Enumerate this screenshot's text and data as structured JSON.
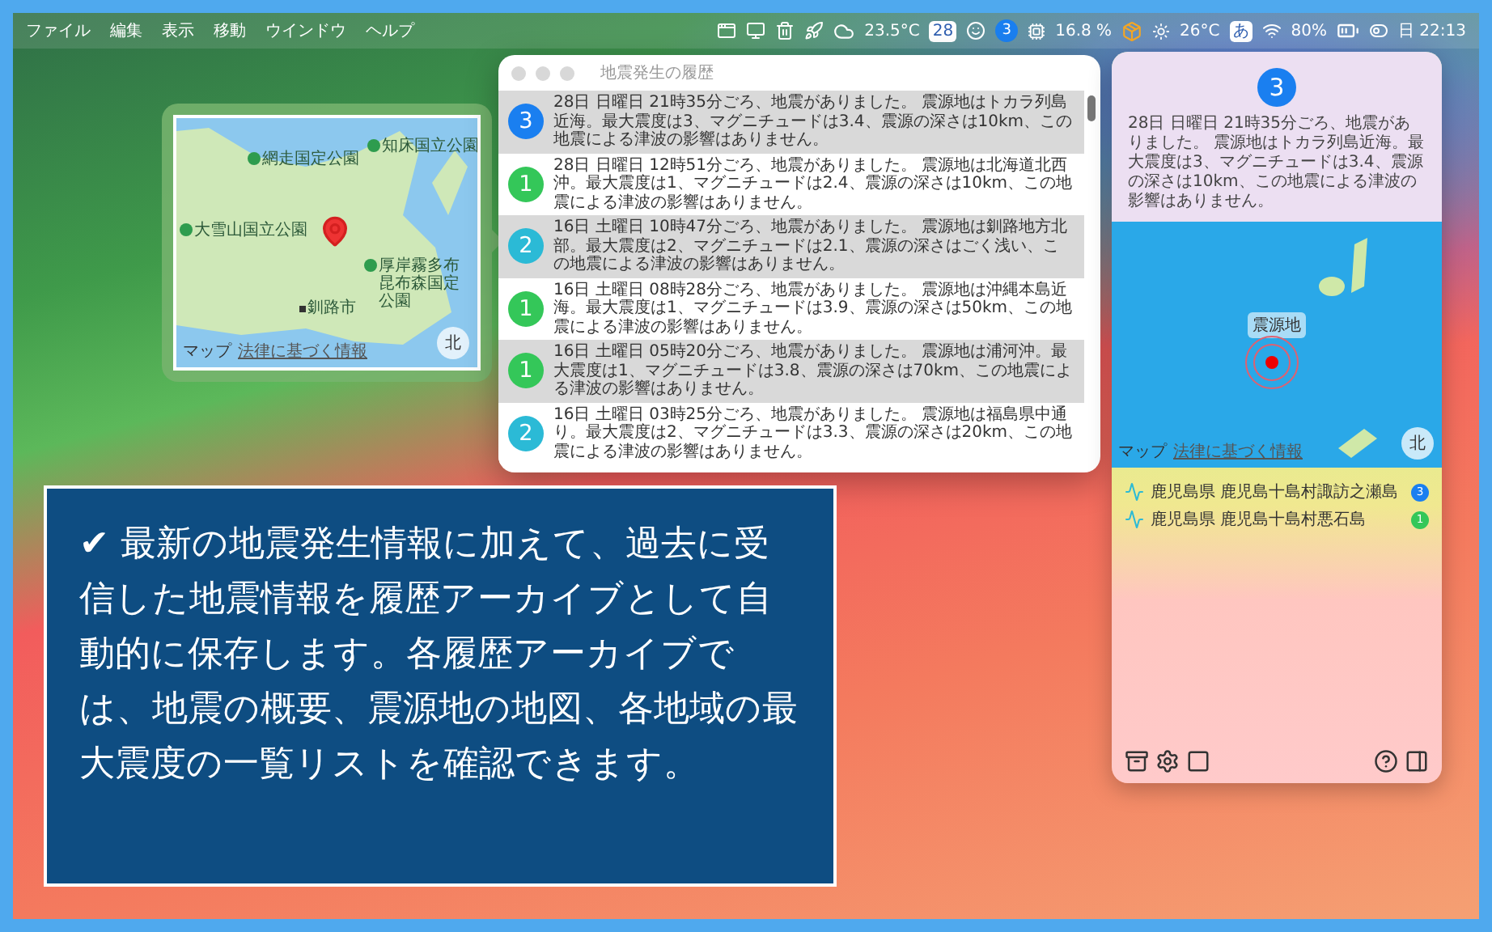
{
  "menu_bar": {
    "menus": [
      "ファイル",
      "編集",
      "表示",
      "移動",
      "ウインドウ",
      "ヘルプ"
    ],
    "status": [
      {
        "kind": "window"
      },
      {
        "kind": "monitor"
      },
      {
        "kind": "trash"
      },
      {
        "kind": "rocket"
      },
      {
        "kind": "weather",
        "text": "23.5°C"
      },
      {
        "kind": "calendar",
        "text": "28"
      },
      {
        "kind": "face"
      },
      {
        "kind": "badge",
        "text": "3"
      },
      {
        "kind": "cpu",
        "text": "16.8 %"
      },
      {
        "kind": "box"
      },
      {
        "kind": "sun",
        "text": "26°C"
      },
      {
        "kind": "input",
        "text": "あ"
      },
      {
        "kind": "wifi"
      },
      {
        "kind": "battery",
        "text": "80%"
      },
      {
        "kind": "toggle"
      },
      {
        "kind": "clock",
        "text": "日 22:13"
      }
    ]
  },
  "map_popover": {
    "labels": [
      {
        "kind": "park",
        "text": "網走国定公園"
      },
      {
        "kind": "park",
        "text": "知床国立公園"
      },
      {
        "kind": "park",
        "text": "大雪山国立公園"
      },
      {
        "kind": "city",
        "text": "釧路市"
      },
      {
        "kind": "park",
        "text": "厚岸霧多布昆布森国定公園"
      }
    ],
    "attribution": "マップ",
    "legal": "法律に基づく情報",
    "compass": "北"
  },
  "history_window": {
    "title": "地震発生の履歴",
    "rows": [
      {
        "intensity": "3",
        "color": "#1a7ff0",
        "text": "28日 日曜日 21時35分ごろ、地震がありました。 震源地はトカラ列島近海。最大震度は3、マグニチュードは3.4、震源の深さは10km、この地震による津波の影響はありません。"
      },
      {
        "intensity": "1",
        "color": "#34c759",
        "text": "28日 日曜日 12時51分ごろ、地震がありました。 震源地は北海道北西沖。最大震度は1、マグニチュードは2.4、震源の深さは10km、この地震による津波の影響はありません。"
      },
      {
        "intensity": "2",
        "color": "#2bbad6",
        "text": "16日 土曜日 10時47分ごろ、地震がありました。 震源地は釧路地方北部。最大震度は2、マグニチュードは2.1、震源の深さはごく浅い、この地震による津波の影響はありません。"
      },
      {
        "intensity": "1",
        "color": "#34c759",
        "text": "16日 土曜日 08時28分ごろ、地震がありました。 震源地は沖縄本島近海。最大震度は1、マグニチュードは3.9、震源の深さは50km、この地震による津波の影響はありません。"
      },
      {
        "intensity": "1",
        "color": "#34c759",
        "text": "16日 土曜日 05時20分ごろ、地震がありました。 震源地は浦河沖。最大震度は1、マグニチュードは3.8、震源の深さは70km、この地震による津波の影響はありません。"
      },
      {
        "intensity": "2",
        "color": "#2bbad6",
        "text": "16日 土曜日 03時25分ごろ、地震がありました。 震源地は福島県中通り。最大震度は2、マグニチュードは3.3、震源の深さは20km、この地震による津波の影響はありません。"
      }
    ]
  },
  "detail_panel": {
    "intensity": "3",
    "color": "#1a7ff0",
    "summary": "28日 日曜日 21時35分ごろ、地震がありました。 震源地はトカラ列島近海。最大震度は3、マグニチュードは3.4、震源の深さは10km、この地震による津波の影響はありません。",
    "map": {
      "epicenter_label": "震源地",
      "attribution": "マップ",
      "legal": "法律に基づく情報",
      "compass": "北"
    },
    "regions": [
      {
        "name": "鹿児島県 鹿児島十島村諏訪之瀬島",
        "intensity": "3",
        "color": "#1a7ff0"
      },
      {
        "name": "鹿児島県 鹿児島十島村悪石島",
        "intensity": "1",
        "color": "#34c759"
      }
    ]
  },
  "caption": {
    "check": "✔",
    "text": "最新の地震発生情報に加えて、過去に受信した地震情報を履歴アーカイブとして自動的に保存します。各履歴アーカイブでは、地震の概要、震源地の地図、各地域の最大震度の一覧リストを確認できます。"
  }
}
